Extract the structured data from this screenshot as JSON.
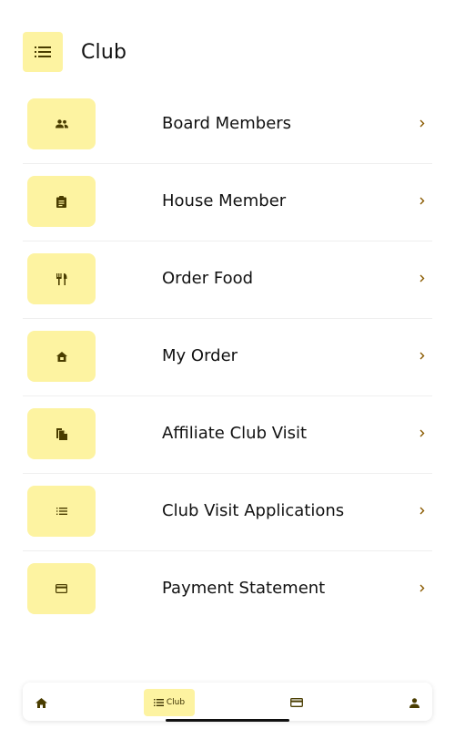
{
  "header": {
    "title": "Club",
    "icon": "list-icon"
  },
  "menu": {
    "items": [
      {
        "label": "Board Members",
        "icon": "people-icon"
      },
      {
        "label": "House Member",
        "icon": "clipboard-icon"
      },
      {
        "label": "Order Food",
        "icon": "restaurant-icon"
      },
      {
        "label": "My Order",
        "icon": "store-icon"
      },
      {
        "label": "Affiliate Club Visit",
        "icon": "documents-icon"
      },
      {
        "label": "Club Visit Applications",
        "icon": "list-icon"
      },
      {
        "label": "Payment Statement",
        "icon": "card-icon"
      }
    ]
  },
  "bottom_nav": {
    "items": [
      {
        "icon": "home-icon"
      },
      {
        "label": "Club",
        "icon": "list-icon",
        "active": true
      },
      {
        "icon": "card-icon"
      },
      {
        "icon": "person-icon"
      }
    ]
  },
  "colors": {
    "accent": "#fdf3a1",
    "icon": "#4a3d00",
    "chevron": "#8a5a00"
  }
}
